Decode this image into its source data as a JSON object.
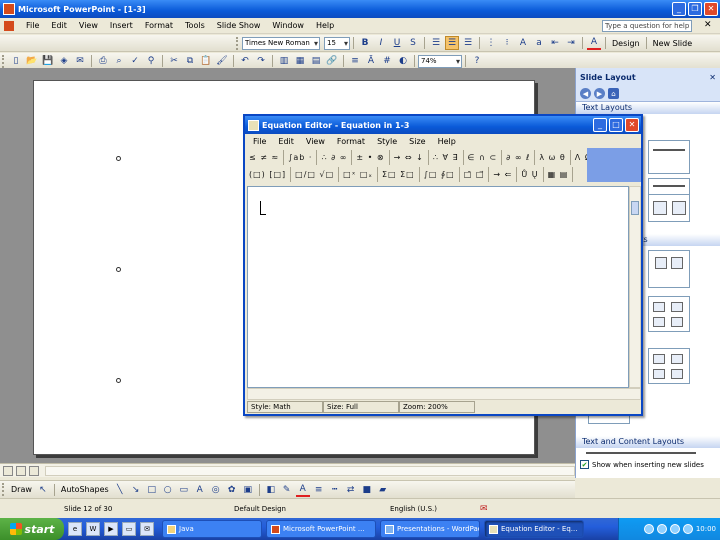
{
  "titlebar": {
    "title": "Microsoft PowerPoint - [1-3]"
  },
  "menubar": {
    "items": [
      "File",
      "Edit",
      "View",
      "Insert",
      "Format",
      "Tools",
      "Slide Show",
      "Window",
      "Help"
    ],
    "help_placeholder": "Type a question for help"
  },
  "formatting_toolbar": {
    "font": "Times New Roman",
    "size": "15",
    "design_label": "Design",
    "new_slide_label": "New Slide"
  },
  "standard_toolbar": {
    "zoom": "74%"
  },
  "task_pane": {
    "title": "Slide Layout",
    "section_text_layouts": "Text Layouts",
    "section_content_layouts": "Content Layouts",
    "section_text_and_content": "Text and Content Layouts",
    "checkbox_label": "Show when inserting new slides"
  },
  "equation_editor": {
    "title": "Equation Editor - Equation in 1-3",
    "menu": [
      "File",
      "Edit",
      "View",
      "Format",
      "Style",
      "Size",
      "Help"
    ],
    "palette_row1": [
      "≤ ≠ ≈",
      "∫ab ·",
      "∴ ∂ ∞",
      "± • ⊗",
      "→ ⇔ ↓",
      "∴ ∀ ∃",
      "∈ ∩ ⊂",
      "∂ ∞ ℓ",
      "λ ω θ",
      "Λ Ω Θ"
    ],
    "palette_row2": [
      "(□) [□]",
      "□/□ √□",
      "□ˣ □ₓ",
      "Σ□ Σ□",
      "∫□ ∮□",
      "□̄ □⃗",
      "→ ⇐",
      "Ů Ų",
      "▦ ▤"
    ],
    "status_style": "Style: Math",
    "status_size": "Size: Full",
    "status_zoom": "Zoom: 200%"
  },
  "drawing_toolbar": {
    "draw_label": "Draw",
    "autoshapes_label": "AutoShapes"
  },
  "statusbar": {
    "slide": "Slide 12 of 30",
    "design": "Default Design",
    "language": "English (U.S.)"
  },
  "taskbar": {
    "start_label": "start",
    "tasks": [
      "Java",
      "Microsoft PowerPoint ...",
      "Presentations - WordPad",
      "Equation Editor - Eq..."
    ],
    "clock": "10:00"
  }
}
